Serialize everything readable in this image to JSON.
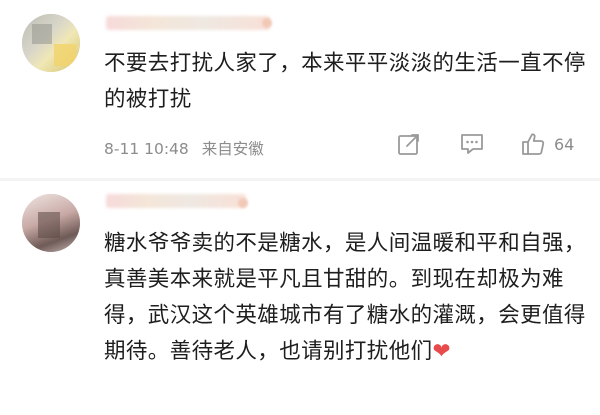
{
  "comments": [
    {
      "text": "不要去打扰人家了，本来平平淡淡的生活一直不停的被打扰",
      "time": "8-11 10:48",
      "location": "来自安徽",
      "likes": "64"
    },
    {
      "text": "糖水爷爷卖的不是糖水，是人间温暖和平和自强，真善美本来就是平凡且甘甜的。到现在却极为难得，武汉这个英雄城市有了糖水的灌溉，会更值得期待。善待老人，也请别打扰他们",
      "emoji": "❤"
    }
  ],
  "icons": {
    "share": "share-icon",
    "reply": "comment-icon",
    "like": "thumbs-up-icon",
    "heart_color": "#e74b4b"
  }
}
